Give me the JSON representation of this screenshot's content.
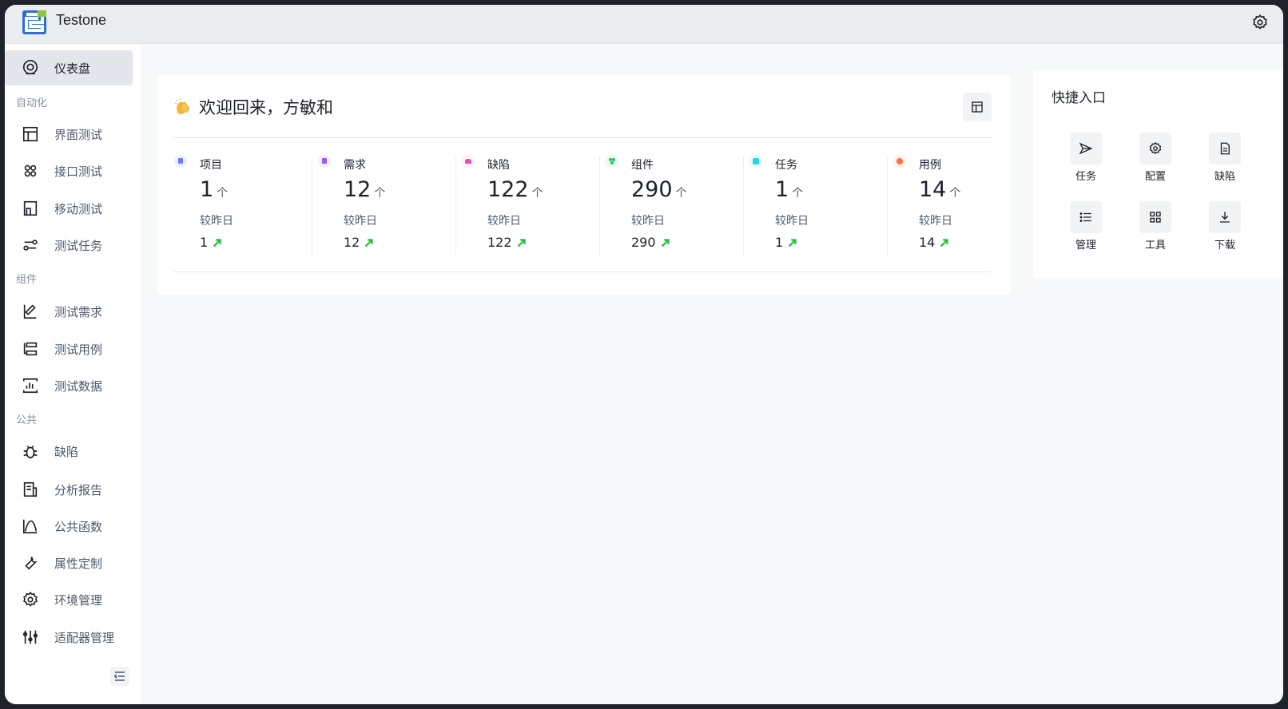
{
  "app": {
    "title": "Testone"
  },
  "sidebar": {
    "items": [
      {
        "label": "仪表盘",
        "icon": "dashboard-icon",
        "active": true
      },
      {
        "label": "界面测试",
        "icon": "layout-icon"
      },
      {
        "label": "接口测试",
        "icon": "api-icon"
      },
      {
        "label": "移动测试",
        "icon": "mobile-icon"
      },
      {
        "label": "测试任务",
        "icon": "task-icon"
      },
      {
        "label": "测试需求",
        "icon": "requirement-icon"
      },
      {
        "label": "测试用例",
        "icon": "testcase-icon"
      },
      {
        "label": "测试数据",
        "icon": "data-icon"
      },
      {
        "label": "缺陷",
        "icon": "bug-icon"
      },
      {
        "label": "分析报告",
        "icon": "report-icon"
      },
      {
        "label": "公共函数",
        "icon": "function-icon"
      },
      {
        "label": "属性定制",
        "icon": "wrench-icon"
      },
      {
        "label": "环境管理",
        "icon": "gear-icon"
      },
      {
        "label": "适配器管理",
        "icon": "sliders-icon"
      }
    ],
    "groups": [
      "自动化",
      "组件",
      "公共"
    ]
  },
  "welcome": {
    "title": "欢迎回来，方敏和"
  },
  "stats": [
    {
      "title": "项目",
      "count": "1",
      "unit": "个",
      "compare_label": "较昨日",
      "delta": "1",
      "color": "#6b7cff"
    },
    {
      "title": "需求",
      "count": "12",
      "unit": "个",
      "compare_label": "较昨日",
      "delta": "12",
      "color": "#9a5cf0"
    },
    {
      "title": "缺陷",
      "count": "122",
      "unit": "个",
      "compare_label": "较昨日",
      "delta": "122",
      "color": "#e24fb8"
    },
    {
      "title": "组件",
      "count": "290",
      "unit": "个",
      "compare_label": "较昨日",
      "delta": "290",
      "color": "#22c55e"
    },
    {
      "title": "任务",
      "count": "1",
      "unit": "个",
      "compare_label": "较昨日",
      "delta": "1",
      "color": "#22d3ee"
    },
    {
      "title": "用例",
      "count": "14",
      "unit": "个",
      "compare_label": "较昨日",
      "delta": "14",
      "color": "#f97340"
    }
  ],
  "quick": {
    "title": "快捷入口",
    "items": [
      {
        "label": "任务",
        "icon": "send-icon"
      },
      {
        "label": "配置",
        "icon": "gear-icon"
      },
      {
        "label": "缺陷",
        "icon": "file-icon"
      },
      {
        "label": "管理",
        "icon": "list-icon"
      },
      {
        "label": "工具",
        "icon": "grid-icon"
      },
      {
        "label": "下载",
        "icon": "download-icon"
      }
    ]
  },
  "colors": {
    "accent_up": "#1fbf3a",
    "active_bg": "#e5e6eb"
  }
}
